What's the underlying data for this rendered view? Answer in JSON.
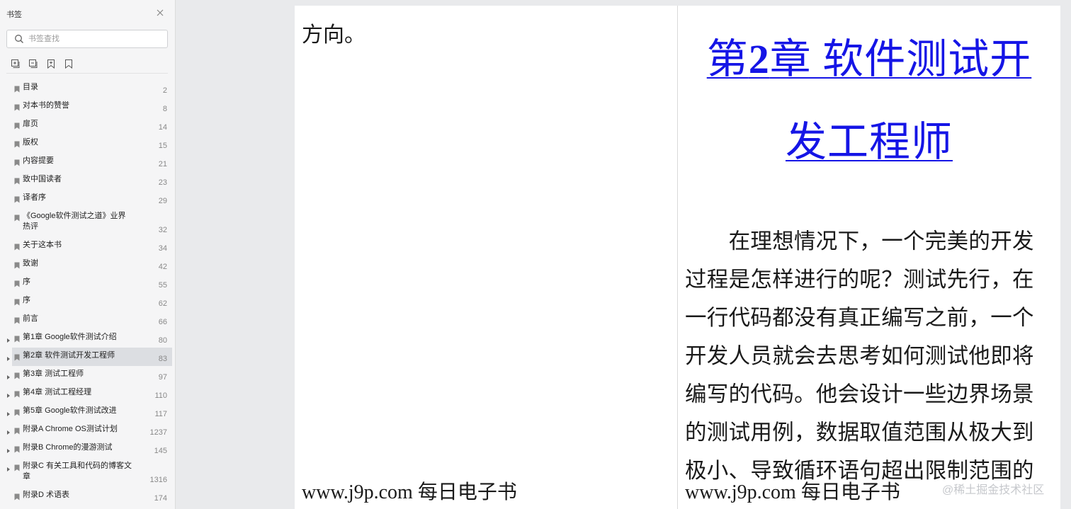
{
  "sidebar": {
    "title": "书签",
    "search_placeholder": "书签查找",
    "tools": [
      "expand-all-icon",
      "collapse-all-icon",
      "add-bookmark-icon",
      "bookmark-icon"
    ],
    "items": [
      {
        "label": "目录",
        "page": "2",
        "expandable": false,
        "active": false
      },
      {
        "label": "对本书的赞誉",
        "page": "8",
        "expandable": false,
        "active": false
      },
      {
        "label": "扉页",
        "page": "14",
        "expandable": false,
        "active": false
      },
      {
        "label": "版权",
        "page": "15",
        "expandable": false,
        "active": false
      },
      {
        "label": "内容提要",
        "page": "21",
        "expandable": false,
        "active": false
      },
      {
        "label": "致中国读者",
        "page": "23",
        "expandable": false,
        "active": false
      },
      {
        "label": "译者序",
        "page": "29",
        "expandable": false,
        "active": false
      },
      {
        "label": "《Google软件测试之道》业界热评",
        "page": "32",
        "expandable": false,
        "active": false
      },
      {
        "label": "关于这本书",
        "page": "34",
        "expandable": false,
        "active": false
      },
      {
        "label": "致谢",
        "page": "42",
        "expandable": false,
        "active": false
      },
      {
        "label": "序",
        "page": "55",
        "expandable": false,
        "active": false
      },
      {
        "label": "序",
        "page": "62",
        "expandable": false,
        "active": false
      },
      {
        "label": "前言",
        "page": "66",
        "expandable": false,
        "active": false
      },
      {
        "label": "第1章 Google软件测试介绍",
        "page": "80",
        "expandable": true,
        "active": false
      },
      {
        "label": "第2章 软件测试开发工程师",
        "page": "83",
        "expandable": true,
        "active": true
      },
      {
        "label": "第3章 测试工程师",
        "page": "97",
        "expandable": true,
        "active": false
      },
      {
        "label": "第4章 测试工程经理",
        "page": "110",
        "expandable": true,
        "active": false
      },
      {
        "label": "第5章 Google软件测试改进",
        "page": "117",
        "expandable": true,
        "active": false
      },
      {
        "label": "附录A Chrome OS测试计划",
        "page": "1237",
        "expandable": true,
        "active": false
      },
      {
        "label": "附录B Chrome的漫游测试",
        "page": "145",
        "expandable": true,
        "active": false
      },
      {
        "label": "附录C 有关工具和代码的博客文章",
        "page": "1316",
        "expandable": true,
        "active": false
      },
      {
        "label": "附录D 术语表",
        "page": "174",
        "expandable": false,
        "active": false
      }
    ]
  },
  "document": {
    "left_page": {
      "text": "方向。",
      "footer": "www.j9p.com 每日电子书"
    },
    "right_page": {
      "chapter_prefix": "第",
      "chapter_number": "2",
      "chapter_line1_rest": "章 软件测试开",
      "chapter_line2": "发工程师",
      "paragraph_lines": [
        "　　在理想情况下，一个完美的开发",
        "过程是怎样进行的呢？测试先行，在",
        "一行代码都没有真正编写之前，一个",
        "开发人员就会去思考如何测试他即将",
        "编写的代码。他会设计一些边界场景",
        "的测试用例，数据取值范围从极大到",
        "极小、导致循环语句超出限制范围的"
      ],
      "footer": "www.j9p.com 每日电子书"
    }
  },
  "watermark": "@稀土掘金技术社区",
  "colors": {
    "link_blue": "#1515e6",
    "sidebar_bg": "#f5f5f6",
    "active_row": "#dcdee2"
  }
}
